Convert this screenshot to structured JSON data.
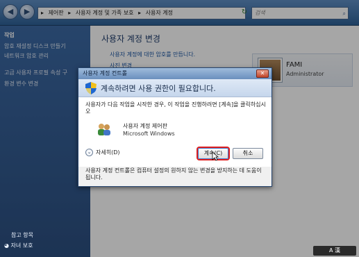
{
  "address": {
    "back_glyph": "◀",
    "forward_glyph": "▶",
    "crumbs": [
      "▸",
      "제어판",
      "▸",
      "사용자 계정 및 가족 보호",
      "▸",
      "사용자 계정"
    ],
    "search_placeholder": "검색"
  },
  "sidebar": {
    "header": "작업",
    "items": [
      "암호 재설정 디스크 만들기",
      "네트워크 암호 관리",
      "고급 사용자 프로필 속성 구",
      "환경 변수 변경"
    ],
    "bottom": [
      "참고 항목",
      "자녀 보호"
    ]
  },
  "main": {
    "title": "사용자 계정 변경",
    "links": [
      "사용자 계정에 대한 암호를 만듭니다.",
      "사진 변경"
    ]
  },
  "user": {
    "name": "FAMI",
    "role": "Administrator"
  },
  "dialog": {
    "title": "사용자 계정 컨트롤",
    "close_glyph": "✕",
    "headline": "계속하려면 사용 권한이 필요합니다.",
    "description": "사용자가 다음 작업을 시작한 경우, 이 작업을 진행하려면 [계속]을 클릭하십시오",
    "program_name": "사용자 계정 제어판",
    "publisher": "Microsoft Windows",
    "details_label": "자세히(D)",
    "details_glyph": "⌄",
    "continue_label": "계속(C)",
    "cancel_label": "취소",
    "footer": "사용자 계정 컨트롤은 컴퓨터 설정의 원하지 않는 변경을 방지하는 데 도움이 됩니다."
  },
  "tray": {
    "label": "A 漢"
  }
}
